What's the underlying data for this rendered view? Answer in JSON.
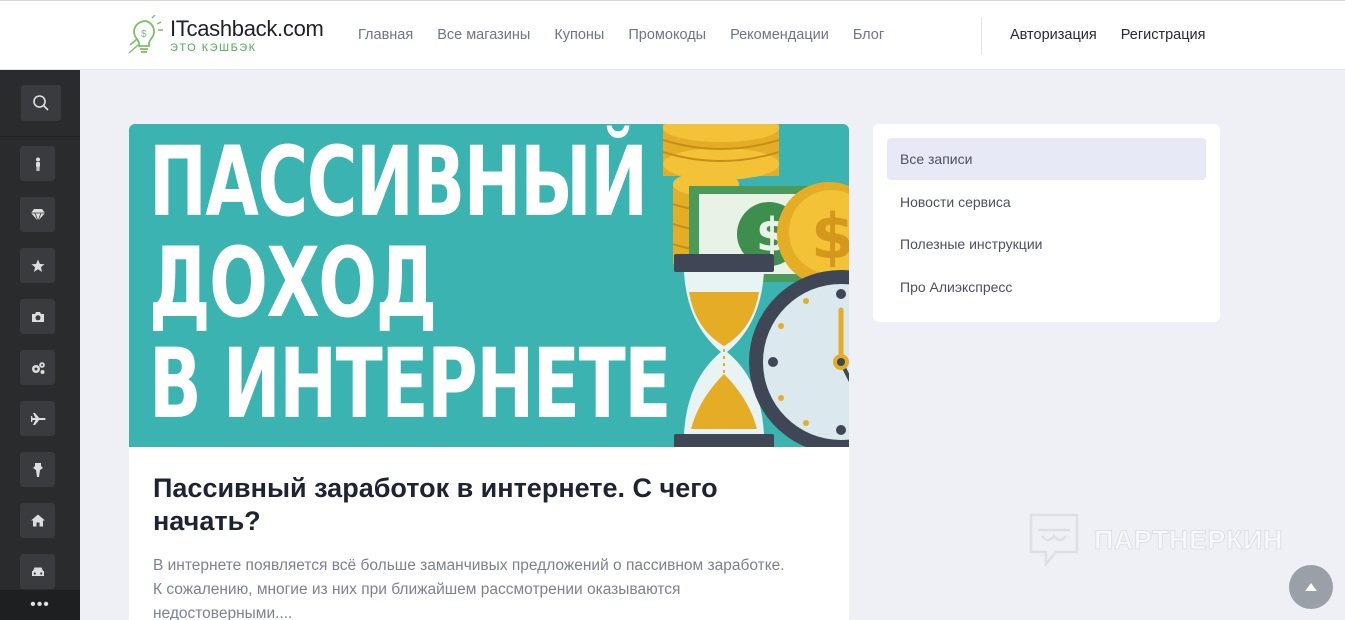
{
  "header": {
    "logo": {
      "title": "ITcashback.com",
      "subtitle": "ЭТО КЭШБЭК"
    },
    "nav": [
      "Главная",
      "Все магазины",
      "Купоны",
      "Промокоды",
      "Рекомендации",
      "Блог"
    ],
    "auth": {
      "login": "Авторизация",
      "register": "Регистрация"
    }
  },
  "sidebar": {
    "icons": [
      "search-icon",
      "person-icon",
      "diamond-icon",
      "star-icon",
      "camera-icon",
      "gears-icon",
      "airplane-icon",
      "suit-icon",
      "home-icon",
      "car-icon"
    ],
    "more": "•••"
  },
  "article": {
    "image_text": [
      "ПАССИВНЫЙ",
      "ДОХОД",
      "В ИНТЕРНЕТЕ"
    ],
    "title": "Пассивный заработок в интернете. С чего начать?",
    "description": "В интернете появляется всё больше заманчивых предложений о пассивном заработке. К сожалению, многие из них при ближайшем рассмотрении оказываются недостоверными...."
  },
  "categories": [
    {
      "label": "Все записи",
      "active": true
    },
    {
      "label": "Новости сервиса",
      "active": false
    },
    {
      "label": "Полезные инструкции",
      "active": false
    },
    {
      "label": "Про Алиэкспресс",
      "active": false
    }
  ],
  "watermark": {
    "text": "ПАРТНЕРКИН"
  },
  "colors": {
    "accent_green": "#4caf50",
    "hero_bg": "#3bb3b0",
    "sidebar_bg": "#2a2b2d",
    "page_bg": "#eef0f5"
  }
}
